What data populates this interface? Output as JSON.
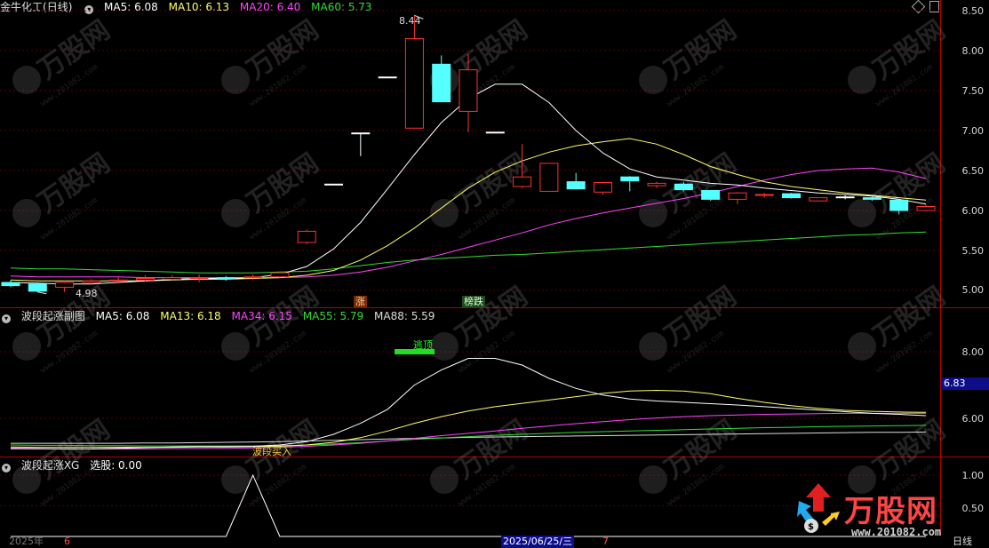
{
  "main_chart": {
    "stock_name": "金牛化工",
    "period": "(日线)",
    "ma5_label": "MA5: 6.08",
    "ma10_label": "MA10: 6.13",
    "ma20_label": "MA20: 6.40",
    "ma60_label": "MA60: 5.73",
    "high_label": "8.44",
    "low_label": "4.98",
    "tag_zhang": "涨",
    "tag_bangdie": "榜跌",
    "y_axis": [
      "8.50",
      "8.00",
      "7.50",
      "7.00",
      "6.50",
      "6.00",
      "5.50",
      "5.00"
    ],
    "colors": {
      "up": "#ff3030",
      "down": "#54ffff",
      "ma5": "#ffffff",
      "ma10": "#ffff66",
      "ma20": "#ff44ff",
      "ma60": "#33dd33"
    }
  },
  "sub_chart": {
    "title": "波段起涨副图",
    "ma5_label": "MA5: 6.08",
    "ma13_label": "MA13: 6.18",
    "ma34_label": "MA34: 6.15",
    "ma55_label": "MA55: 5.79",
    "ma88_label": "MA88: 5.59",
    "signal_top": "逃顶",
    "signal_buy": "波段买入",
    "y_axis": [
      "8.00",
      "6.00"
    ],
    "price_box": "6.83"
  },
  "xg_chart": {
    "title": "波段起涨XG",
    "value_label": "选股: 0.00",
    "y_axis": [
      "1.00",
      "0.50"
    ]
  },
  "timeline": {
    "year": "2025年",
    "month_start": "6",
    "cursor_date": "2025/06/25/三",
    "month_next": "7",
    "period": "日线"
  },
  "watermark": {
    "logo": "万股网",
    "url": "www.201082.com"
  },
  "chart_data": {
    "type": "candlestick",
    "title": "金牛化工 (日线)",
    "y_range": [
      4.9,
      8.6
    ],
    "candles": [
      {
        "o": 5.1,
        "c": 5.06,
        "h": 5.13,
        "l": 5.04
      },
      {
        "o": 5.08,
        "c": 4.99,
        "h": 5.1,
        "l": 4.98
      },
      {
        "o": 5.04,
        "c": 5.1,
        "h": 5.12,
        "l": 4.98
      },
      {
        "o": 5.1,
        "c": 5.12,
        "h": 5.14,
        "l": 5.08
      },
      {
        "o": 5.12,
        "c": 5.13,
        "h": 5.17,
        "l": 5.09
      },
      {
        "o": 5.13,
        "c": 5.15,
        "h": 5.19,
        "l": 5.11
      },
      {
        "o": 5.14,
        "c": 5.16,
        "h": 5.19,
        "l": 5.12
      },
      {
        "o": 5.15,
        "c": 5.16,
        "h": 5.2,
        "l": 5.1
      },
      {
        "o": 5.16,
        "c": 5.15,
        "h": 5.18,
        "l": 5.12
      },
      {
        "o": 5.16,
        "c": 5.17,
        "h": 5.2,
        "l": 5.13
      },
      {
        "o": 5.17,
        "c": 5.22,
        "h": 5.24,
        "l": 5.15
      },
      {
        "o": 5.6,
        "c": 5.74,
        "h": 5.76,
        "l": 5.58
      },
      {
        "o": 6.33,
        "c": 6.33,
        "h": 6.33,
        "l": 6.33
      },
      {
        "o": 6.97,
        "c": 6.97,
        "h": 6.97,
        "l": 6.68
      },
      {
        "o": 7.67,
        "c": 7.67,
        "h": 7.67,
        "l": 7.67
      },
      {
        "o": 7.03,
        "c": 8.15,
        "h": 8.44,
        "l": 7.03
      },
      {
        "o": 7.83,
        "c": 7.36,
        "h": 7.94,
        "l": 7.36
      },
      {
        "o": 7.24,
        "c": 7.76,
        "h": 7.96,
        "l": 6.98
      },
      {
        "o": 6.98,
        "c": 6.98,
        "h": 6.98,
        "l": 6.98
      },
      {
        "o": 6.3,
        "c": 6.42,
        "h": 6.83,
        "l": 6.28
      },
      {
        "o": 6.24,
        "c": 6.59,
        "h": 6.59,
        "l": 6.24
      },
      {
        "o": 6.36,
        "c": 6.27,
        "h": 6.47,
        "l": 6.27
      },
      {
        "o": 6.23,
        "c": 6.35,
        "h": 6.35,
        "l": 6.2
      },
      {
        "o": 6.42,
        "c": 6.37,
        "h": 6.43,
        "l": 6.24
      },
      {
        "o": 6.31,
        "c": 6.34,
        "h": 6.36,
        "l": 6.28
      },
      {
        "o": 6.33,
        "c": 6.26,
        "h": 6.36,
        "l": 6.24
      },
      {
        "o": 6.25,
        "c": 6.14,
        "h": 6.25,
        "l": 6.12
      },
      {
        "o": 6.14,
        "c": 6.22,
        "h": 6.23,
        "l": 6.08
      },
      {
        "o": 6.19,
        "c": 6.2,
        "h": 6.22,
        "l": 6.16
      },
      {
        "o": 6.21,
        "c": 6.16,
        "h": 6.22,
        "l": 6.15
      },
      {
        "o": 6.12,
        "c": 6.16,
        "h": 6.16,
        "l": 6.12
      },
      {
        "o": 6.17,
        "c": 6.17,
        "h": 6.19,
        "l": 6.14
      },
      {
        "o": 6.16,
        "c": 6.14,
        "h": 6.19,
        "l": 6.12
      },
      {
        "o": 6.13,
        "c": 6.0,
        "h": 6.13,
        "l": 5.95
      },
      {
        "o": 6.0,
        "c": 6.05,
        "h": 6.07,
        "l": 5.99
      }
    ],
    "ma5": [
      5.1,
      5.09,
      5.08,
      5.08,
      5.1,
      5.12,
      5.14,
      5.15,
      5.15,
      5.16,
      5.2,
      5.3,
      5.52,
      5.85,
      6.27,
      6.7,
      7.1,
      7.4,
      7.58,
      7.58,
      7.35,
      7.0,
      6.72,
      6.52,
      6.42,
      6.38,
      6.34,
      6.32,
      6.28,
      6.25,
      6.22,
      6.2,
      6.18,
      6.14,
      6.08
    ],
    "ma10": [
      5.13,
      5.12,
      5.12,
      5.12,
      5.12,
      5.12,
      5.13,
      5.14,
      5.14,
      5.15,
      5.16,
      5.19,
      5.25,
      5.38,
      5.56,
      5.78,
      6.03,
      6.28,
      6.48,
      6.62,
      6.73,
      6.81,
      6.86,
      6.9,
      6.83,
      6.7,
      6.55,
      6.45,
      6.36,
      6.3,
      6.26,
      6.22,
      6.19,
      6.16,
      6.13
    ],
    "ma20": [
      5.18,
      5.17,
      5.17,
      5.17,
      5.17,
      5.16,
      5.16,
      5.16,
      5.16,
      5.16,
      5.16,
      5.17,
      5.19,
      5.23,
      5.29,
      5.37,
      5.45,
      5.54,
      5.63,
      5.72,
      5.82,
      5.9,
      5.97,
      6.03,
      6.09,
      6.15,
      6.22,
      6.3,
      6.38,
      6.45,
      6.5,
      6.52,
      6.53,
      6.48,
      6.4
    ],
    "ma60": [
      5.28,
      5.27,
      5.27,
      5.26,
      5.25,
      5.24,
      5.23,
      5.22,
      5.22,
      5.22,
      5.23,
      5.24,
      5.27,
      5.31,
      5.35,
      5.38,
      5.4,
      5.42,
      5.44,
      5.45,
      5.47,
      5.49,
      5.51,
      5.53,
      5.55,
      5.57,
      5.59,
      5.61,
      5.63,
      5.65,
      5.67,
      5.69,
      5.7,
      5.72,
      5.73
    ],
    "sub_y_range": [
      5.0,
      8.6
    ],
    "sub_ma5": [
      5.1,
      5.09,
      5.08,
      5.08,
      5.1,
      5.12,
      5.14,
      5.15,
      5.15,
      5.16,
      5.2,
      5.3,
      5.52,
      5.85,
      6.27,
      7.0,
      7.45,
      7.8,
      7.8,
      7.6,
      7.2,
      6.9,
      6.7,
      6.58,
      6.52,
      6.48,
      6.44,
      6.4,
      6.35,
      6.3,
      6.25,
      6.2,
      6.15,
      6.12,
      6.08
    ],
    "sub_ma13": [
      5.14,
      5.13,
      5.13,
      5.13,
      5.13,
      5.13,
      5.13,
      5.14,
      5.14,
      5.15,
      5.16,
      5.2,
      5.28,
      5.42,
      5.62,
      5.85,
      6.05,
      6.22,
      6.35,
      6.45,
      6.55,
      6.65,
      6.75,
      6.82,
      6.84,
      6.82,
      6.74,
      6.6,
      6.48,
      6.38,
      6.3,
      6.24,
      6.21,
      6.19,
      6.18
    ],
    "sub_ma34": [
      5.08,
      5.08,
      5.08,
      5.08,
      5.08,
      5.08,
      5.09,
      5.09,
      5.1,
      5.11,
      5.13,
      5.16,
      5.2,
      5.25,
      5.32,
      5.4,
      5.48,
      5.55,
      5.62,
      5.7,
      5.77,
      5.84,
      5.9,
      5.96,
      6.01,
      6.05,
      6.08,
      6.1,
      6.12,
      6.13,
      6.14,
      6.15,
      6.15,
      6.15,
      6.15
    ],
    "sub_ma55": [
      5.2,
      5.19,
      5.19,
      5.18,
      5.18,
      5.17,
      5.17,
      5.17,
      5.17,
      5.17,
      5.18,
      5.2,
      5.23,
      5.27,
      5.32,
      5.37,
      5.41,
      5.45,
      5.49,
      5.52,
      5.55,
      5.58,
      5.6,
      5.62,
      5.64,
      5.66,
      5.68,
      5.7,
      5.72,
      5.73,
      5.75,
      5.76,
      5.77,
      5.78,
      5.79
    ],
    "sub_ma88": [
      5.25,
      5.25,
      5.25,
      5.25,
      5.25,
      5.26,
      5.26,
      5.27,
      5.28,
      5.29,
      5.3,
      5.32,
      5.34,
      5.36,
      5.38,
      5.4,
      5.41,
      5.43,
      5.44,
      5.45,
      5.46,
      5.47,
      5.48,
      5.49,
      5.5,
      5.51,
      5.52,
      5.53,
      5.54,
      5.55,
      5.56,
      5.57,
      5.58,
      5.58,
      5.59
    ],
    "xg_values": [
      0,
      0,
      0,
      0,
      0,
      0,
      0,
      0,
      0,
      1,
      0,
      0,
      0,
      0,
      0,
      0,
      0,
      0,
      0,
      0,
      0,
      0,
      0,
      0,
      0,
      0,
      0,
      0,
      0,
      0,
      0,
      0,
      0,
      0,
      0
    ]
  }
}
